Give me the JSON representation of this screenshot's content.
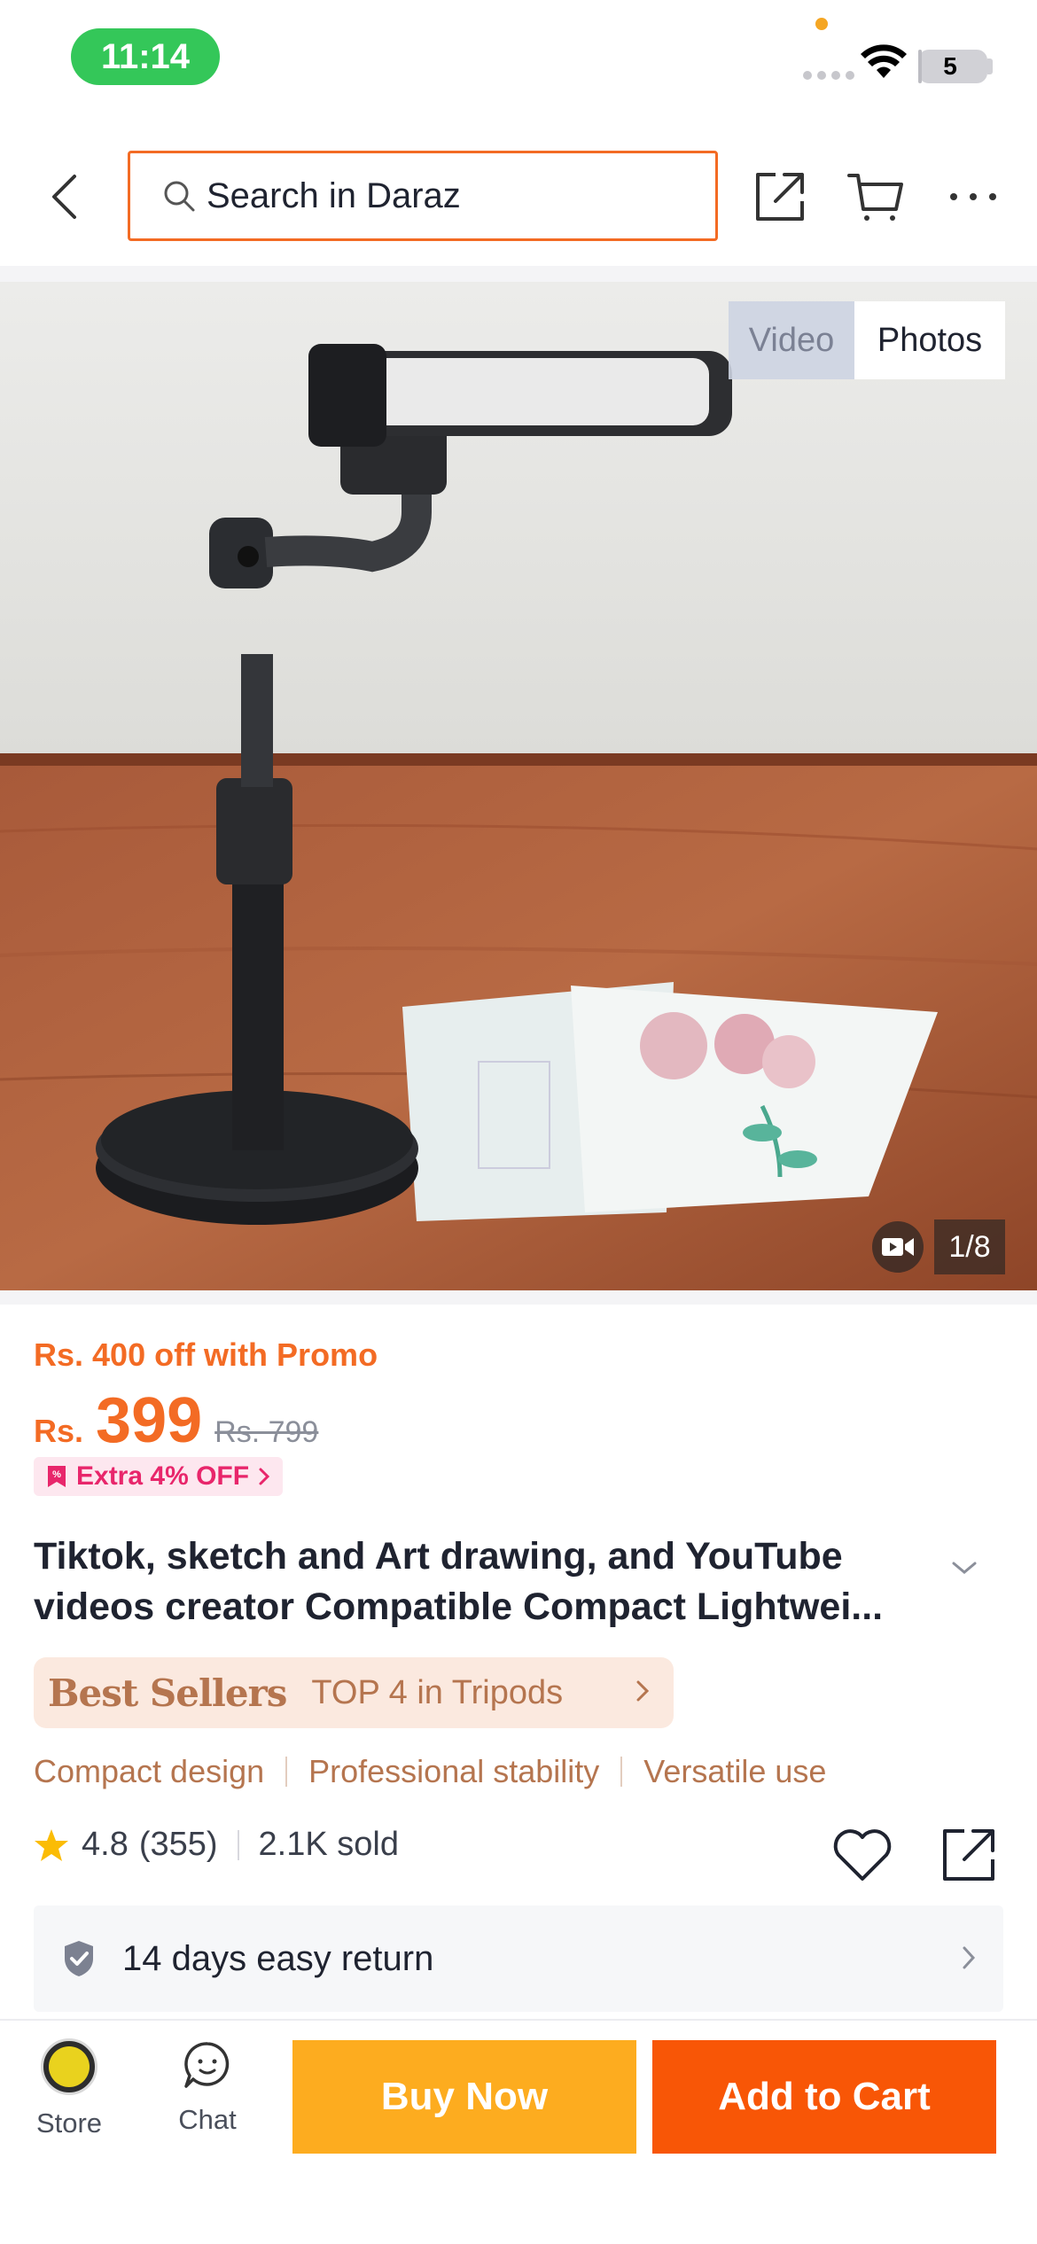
{
  "status_bar": {
    "time": "11:14",
    "battery": "5",
    "battery_level": 0.05
  },
  "header": {
    "search_placeholder": "Search in Daraz",
    "icons": [
      "back-icon",
      "search-icon",
      "share-icon",
      "cart-icon",
      "more-icon"
    ]
  },
  "gallery": {
    "tab_video": "Video",
    "tab_photos": "Photos",
    "counter": "1/8",
    "active_tab": "Photos"
  },
  "price": {
    "promo": "Rs. 400 off with Promo",
    "currency": "Rs.",
    "current": "399",
    "original": "Rs. 799",
    "extra_off": "Extra 4% OFF",
    "accent_color": "#f36b24"
  },
  "product": {
    "title": "Tiktok, sketch and Art drawing, and YouTube videos creator Compatible Compact Lightwei..."
  },
  "best_sellers": {
    "logo": "Best Sellers",
    "rank": "TOP 4 in Tripods"
  },
  "features": [
    "Compact design",
    "Professional stability",
    "Versatile use"
  ],
  "rating": {
    "score": "4.8",
    "count": "(355)",
    "sold": "2.1K sold"
  },
  "return_policy": {
    "text": "14 days easy return"
  },
  "bottom_bar": {
    "store_label": "Store",
    "chat_label": "Chat",
    "buy_now": "Buy Now",
    "add_to_cart": "Add to Cart",
    "buy_color": "#fdac1f",
    "cart_color": "#f85606"
  }
}
